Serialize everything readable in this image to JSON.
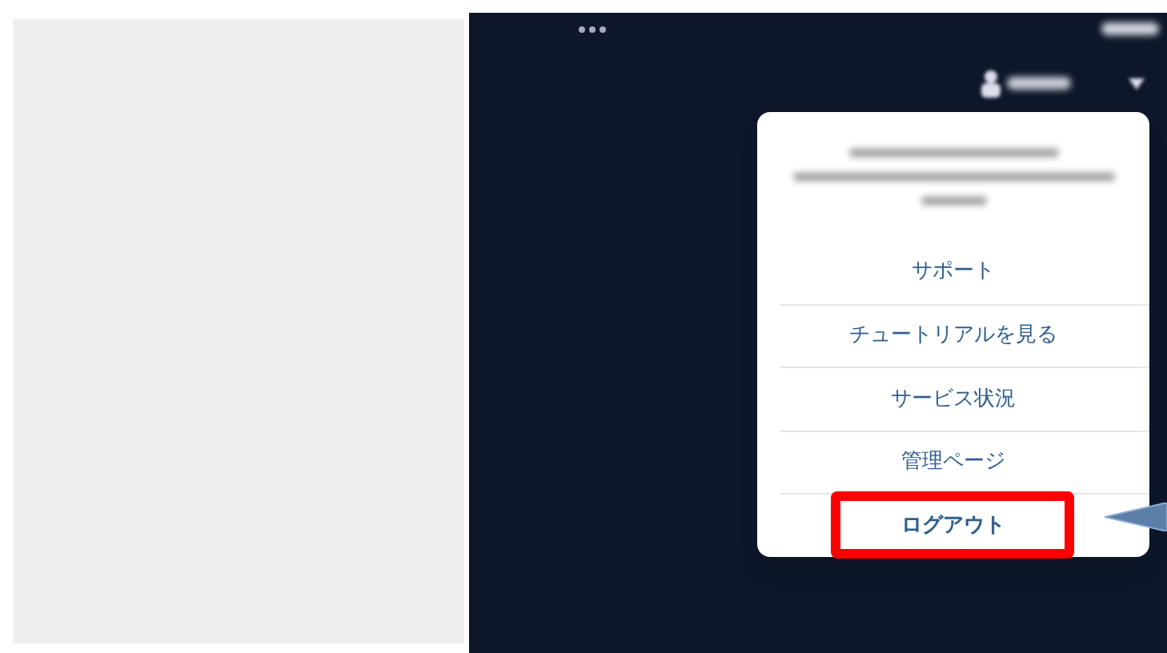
{
  "menu": {
    "items": [
      {
        "label": "サポート",
        "highlighted": false
      },
      {
        "label": "チュートリアルを見る",
        "highlighted": false
      },
      {
        "label": "サービス状況",
        "highlighted": false
      },
      {
        "label": "管理ページ",
        "highlighted": false
      },
      {
        "label": "ログアウト",
        "highlighted": true
      }
    ]
  }
}
